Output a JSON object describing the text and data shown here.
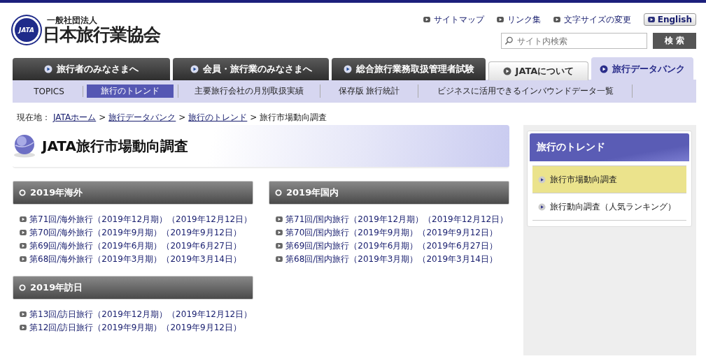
{
  "header": {
    "logo": {
      "mark": "JATA",
      "org_type": "一般社団法人",
      "name": "日本旅行業協会"
    },
    "utility_links": [
      "サイトマップ",
      "リンク集",
      "文字サイズの変更"
    ],
    "language_button": "English",
    "search": {
      "placeholder": "サイト内検索",
      "button": "検 索"
    }
  },
  "main_tabs": [
    {
      "label": "旅行者のみなさまへ",
      "kind": "primary",
      "selected": false
    },
    {
      "label": "会員・旅行業のみなさまへ",
      "kind": "primary",
      "selected": false
    },
    {
      "label": "総合旅行業務取扱管理者試験",
      "kind": "primary",
      "selected": false
    },
    {
      "label": "JATAについて",
      "kind": "secondary",
      "selected": false
    },
    {
      "label": "旅行データバンク",
      "kind": "secondary",
      "selected": true
    }
  ],
  "sub_nav": [
    {
      "label": "TOPICS",
      "selected": false
    },
    {
      "label": "旅行のトレンド",
      "selected": true
    },
    {
      "label": "主要旅行会社の月別取扱実績",
      "selected": false
    },
    {
      "label": "保存版 旅行統計",
      "selected": false
    },
    {
      "label": "ビジネスに活用できるインバウンドデータ一覧",
      "selected": false
    }
  ],
  "breadcrumb": {
    "label": "現在地：",
    "separator": ">",
    "links": [
      "JATAホーム",
      "旅行データバンク",
      "旅行のトレンド"
    ],
    "current": "旅行市場動向調査"
  },
  "page_title": "JATA旅行市場動向調査",
  "sections": [
    {
      "title": "2019年海外",
      "items": [
        "第71回/海外旅行（2019年12月期）（2019年12月12日）",
        "第70回/海外旅行（2019年9月期）（2019年9月12日）",
        "第69回/海外旅行（2019年6月期）（2019年6月27日）",
        "第68回/海外旅行（2019年3月期）（2019年3月14日）"
      ]
    },
    {
      "title": "2019年国内",
      "items": [
        "第71回/国内旅行（2019年12月期）（2019年12月12日）",
        "第70回/国内旅行（2019年9月期）（2019年9月12日）",
        "第69回/国内旅行（2019年6月期）（2019年6月27日）",
        "第68回/国内旅行（2019年3月期）（2019年3月14日）"
      ]
    },
    {
      "title": "2019年訪日",
      "items": [
        "第13回/訪日旅行（2019年12月期）（2019年12月12日）",
        "第12回/訪日旅行（2019年9月期）（2019年9月12日）"
      ]
    }
  ],
  "sidebar": {
    "title": "旅行のトレンド",
    "items": [
      {
        "label": "旅行市場動向調査",
        "selected": true
      },
      {
        "label": "旅行動向調査（人気ランキング）",
        "selected": false
      }
    ]
  }
}
